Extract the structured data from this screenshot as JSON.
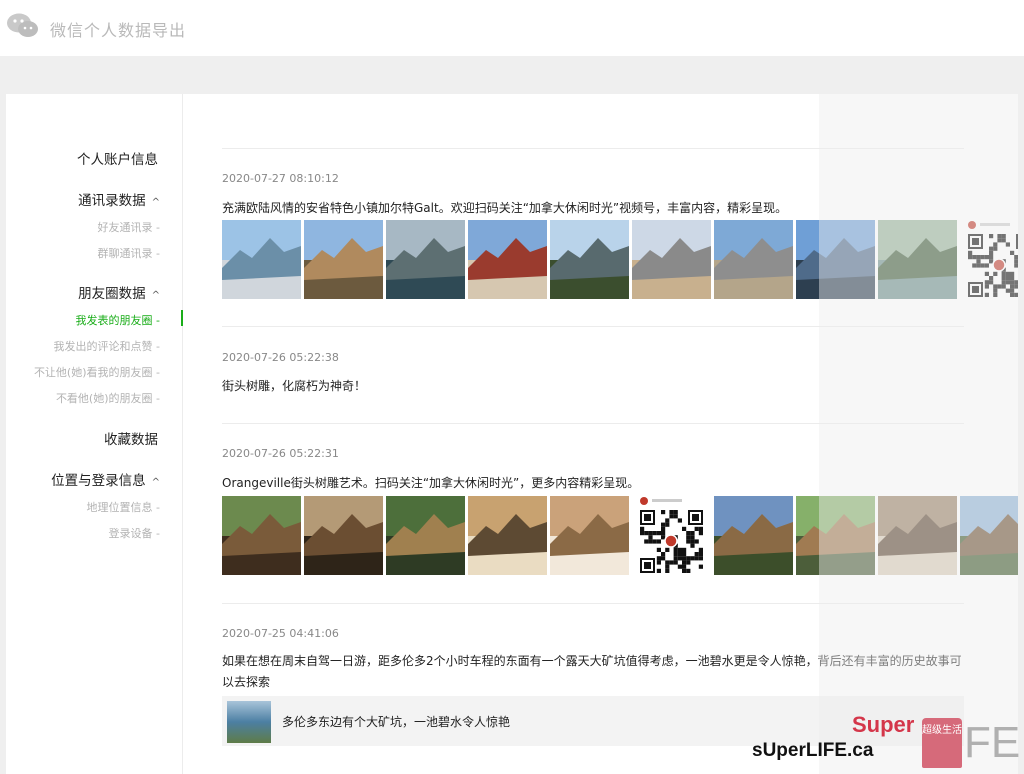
{
  "app": {
    "title": "微信个人数据导出",
    "logo_icon": "wechat-icon"
  },
  "sidebar": {
    "groups": [
      {
        "label": "个人账户信息"
      },
      {
        "label": "通讯录数据",
        "chevron": "^",
        "items": [
          "好友通讯录 -",
          "群聊通讯录 -"
        ]
      },
      {
        "label": "朋友圈数据",
        "chevron": "^",
        "items": [
          "我发表的朋友圈 -",
          "我发出的评论和点赞 -",
          "不让他(她)看我的朋友圈 -",
          "不看他(她)的朋友圈 -"
        ]
      },
      {
        "label": "收藏数据"
      },
      {
        "label": "位置与登录信息",
        "chevron": "^",
        "items": [
          "地理位置信息 -",
          "登录设备 -"
        ]
      }
    ],
    "active_item": "我发表的朋友圈 -",
    "accent_color": "#1aad19"
  },
  "posts": [
    {
      "time": "2020-07-27 08:10:12",
      "text": "充满欧陆风情的安省特色小镇加尔特Galt。欢迎扫码关注“加拿大休闲时光”视频号，丰富内容，精彩呈现。",
      "photos": [
        "bridge-river-photo",
        "stone-church-photo",
        "river-rapids-photo",
        "red-brick-building-photo",
        "church-spire-riverside-photo",
        "person-by-river-photo",
        "stone-railing-photo",
        "river-town-skyline-photo",
        "river-park-photo",
        "qr-code-image"
      ]
    },
    {
      "time": "2020-07-26 05:22:38",
      "text": "街头树雕，化腐朽为神奇！",
      "photos": []
    },
    {
      "time": "2020-07-26 05:22:31",
      "text": "Orangeville街头树雕艺术。扫码关注“加拿大休闲时光”，更多内容精彩呈现。",
      "photos": [
        "wood-carving-man-photo",
        "wood-carving-detail-photo",
        "garden-carving-photo",
        "carved-figure-photo",
        "wolf-carving-photo",
        "qr-code-image",
        "bear-carving-photo",
        "figure-carving-lawn-photo",
        "owl-carving-photo",
        "soldier-carving-photo"
      ]
    },
    {
      "time": "2020-07-25 04:41:06",
      "text": "如果在想在周末自驾一日游，距多伦多2个小时车程的东面有一个露天大矿坑值得考虑，一池碧水更是令人惊艳，背后还有丰富的历史故事可以去探索",
      "link": {
        "title": "多伦多东边有个大矿坑，一池碧水令人惊艳",
        "thumb_icon": "lake-thumbnail"
      }
    }
  ],
  "watermark": {
    "site": "sUperLIFE.ca",
    "logo_super": "Super",
    "logo_fe": "FE",
    "logo_tag": "超级生活"
  }
}
